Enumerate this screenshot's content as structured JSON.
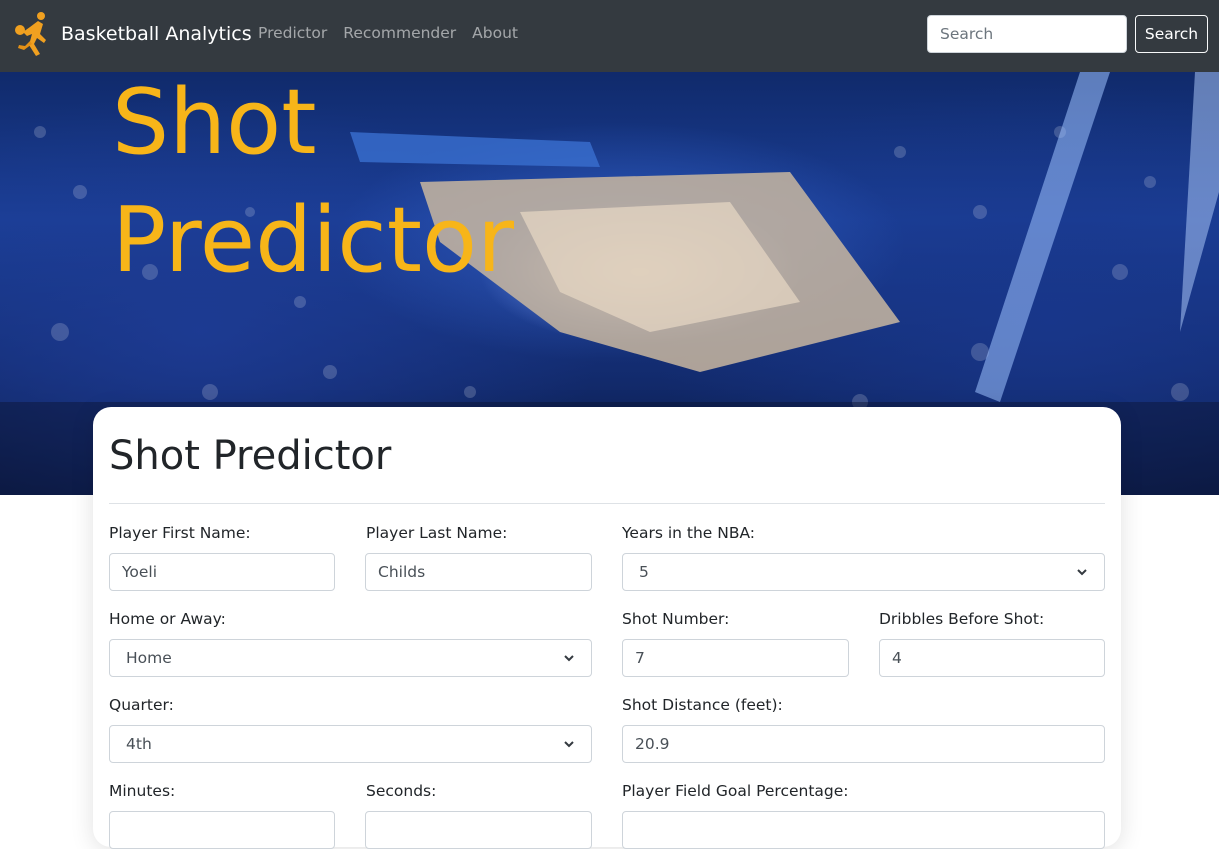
{
  "navbar": {
    "brand": "Basketball Analytics",
    "links": [
      "Predictor",
      "Recommender",
      "About"
    ],
    "search_placeholder": "Search",
    "search_button": "Search"
  },
  "hero": {
    "title": "Shot Predictor"
  },
  "form": {
    "title": "Shot Predictor",
    "first_name": {
      "label": "Player First Name:",
      "value": "Yoeli"
    },
    "last_name": {
      "label": "Player Last Name:",
      "value": "Childs"
    },
    "years": {
      "label": "Years in the NBA:",
      "value": "5"
    },
    "home_away": {
      "label": "Home or Away:",
      "value": "Home"
    },
    "shot_number": {
      "label": "Shot Number:",
      "value": "7"
    },
    "dribbles": {
      "label": "Dribbles Before Shot:",
      "value": "4"
    },
    "quarter": {
      "label": "Quarter:",
      "value": "4th"
    },
    "shot_distance": {
      "label": "Shot Distance (feet):",
      "value": "20.9"
    },
    "minutes": {
      "label": "Minutes:"
    },
    "seconds": {
      "label": "Seconds:"
    },
    "fg_pct": {
      "label": "Player Field Goal Percentage:"
    }
  },
  "colors": {
    "navbar": "#343a40",
    "hero_title": "#f7b519",
    "logo": "#f0a020"
  }
}
